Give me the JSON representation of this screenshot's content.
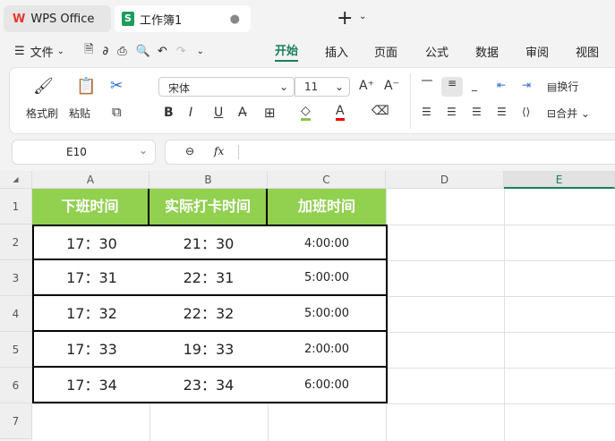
{
  "titlebar": {
    "app_tab": "WPS Office",
    "doc_tab": "工作簿1",
    "new_tab": "+"
  },
  "menu": {
    "file": "文件",
    "tabs": [
      "开始",
      "插入",
      "页面",
      "公式",
      "数据",
      "审阅",
      "视图"
    ]
  },
  "ribbon": {
    "format_painter": "格式刷",
    "paste": "粘贴",
    "font_name": "宋体",
    "font_size": "11",
    "wrap": "换行",
    "merge": "合并",
    "bold": "B",
    "italic": "I",
    "underline": "U"
  },
  "formula_bar": {
    "cell_ref": "E10",
    "fx": "fx",
    "value": ""
  },
  "sheet": {
    "columns": [
      "A",
      "B",
      "C",
      "D",
      "E"
    ],
    "rows": [
      "1",
      "2",
      "3",
      "4",
      "5",
      "6",
      "7"
    ],
    "headers": [
      "下班时间",
      "实际打卡时间",
      "加班时间"
    ],
    "data": [
      [
        "17：30",
        "21：30",
        "4:00:00"
      ],
      [
        "17：31",
        "22：31",
        "5:00:00"
      ],
      [
        "17：32",
        "22：32",
        "5:00:00"
      ],
      [
        "17：33",
        "19：33",
        "2:00:00"
      ],
      [
        "17：34",
        "23：34",
        "6:00:00"
      ]
    ]
  },
  "colors": {
    "header_fill": "#92d050",
    "accent": "#1a7f5a"
  }
}
